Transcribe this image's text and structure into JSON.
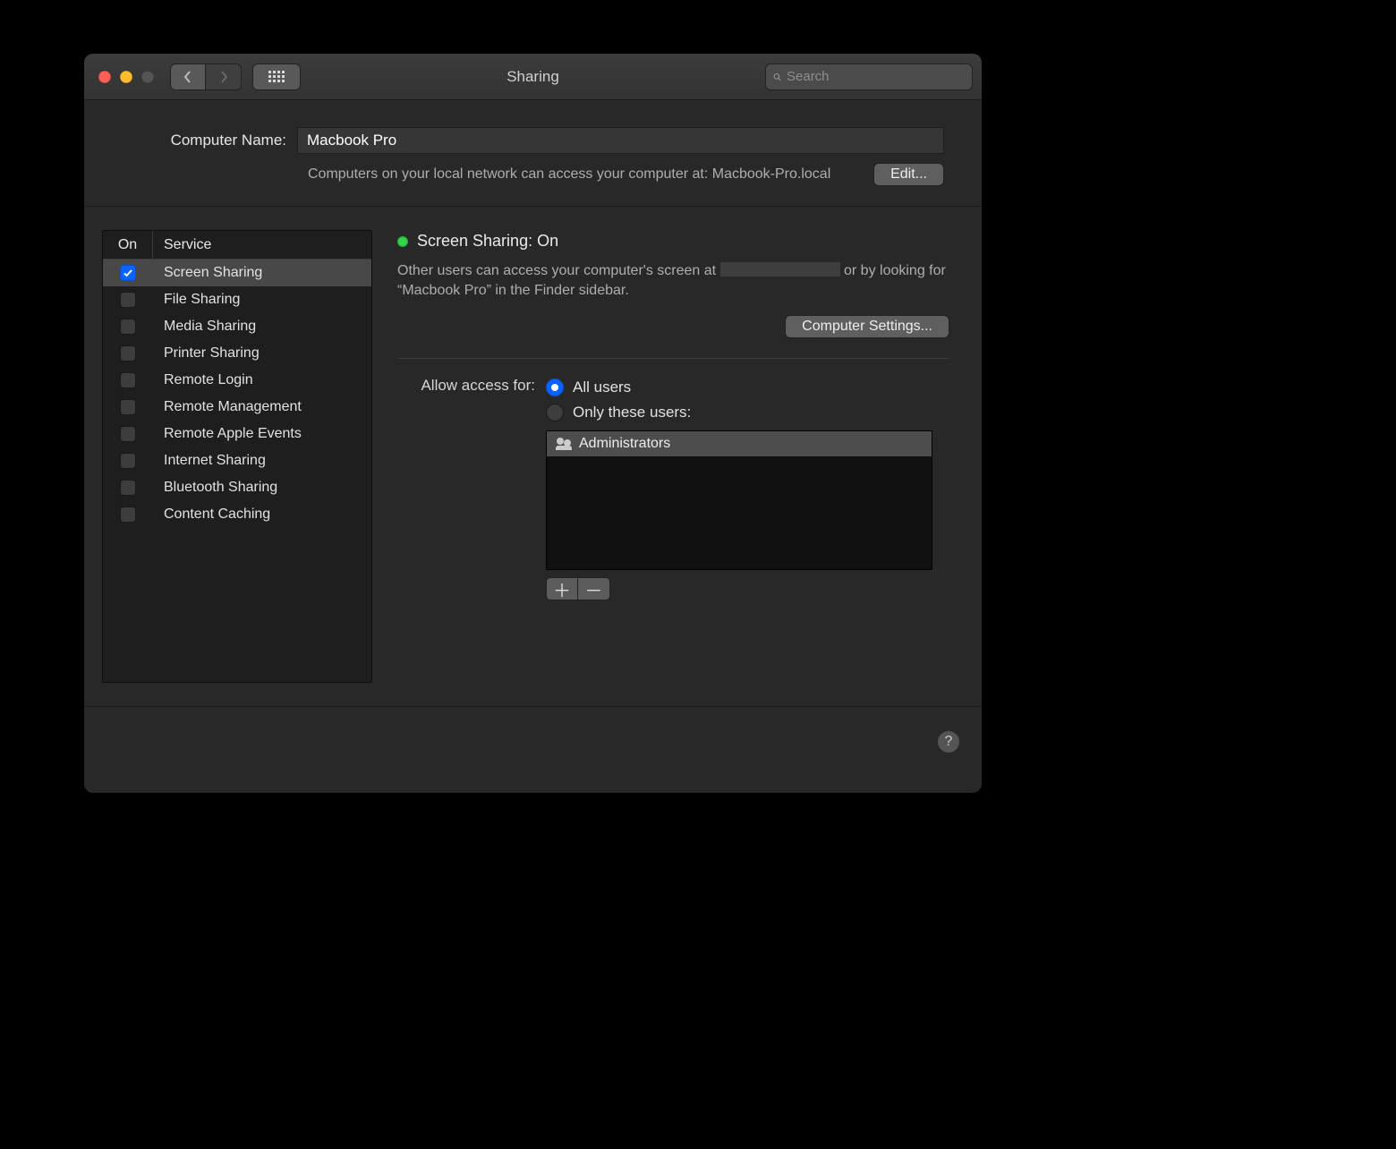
{
  "window": {
    "title": "Sharing"
  },
  "search": {
    "placeholder": "Search"
  },
  "header": {
    "nameLabel": "Computer Name:",
    "nameValue": "Macbook Pro",
    "subtext": "Computers on your local network can access your computer at: Macbook-Pro.local",
    "editLabel": "Edit..."
  },
  "services": {
    "head": {
      "on": "On",
      "service": "Service"
    },
    "rows": [
      {
        "id": "screen-sharing",
        "label": "Screen Sharing",
        "on": true,
        "selected": true
      },
      {
        "id": "file-sharing",
        "label": "File Sharing",
        "on": false,
        "selected": false
      },
      {
        "id": "media-sharing",
        "label": "Media Sharing",
        "on": false,
        "selected": false
      },
      {
        "id": "printer-sharing",
        "label": "Printer Sharing",
        "on": false,
        "selected": false
      },
      {
        "id": "remote-login",
        "label": "Remote Login",
        "on": false,
        "selected": false
      },
      {
        "id": "remote-management",
        "label": "Remote Management",
        "on": false,
        "selected": false
      },
      {
        "id": "remote-apple-events",
        "label": "Remote Apple Events",
        "on": false,
        "selected": false
      },
      {
        "id": "internet-sharing",
        "label": "Internet Sharing",
        "on": false,
        "selected": false
      },
      {
        "id": "bluetooth-sharing",
        "label": "Bluetooth Sharing",
        "on": false,
        "selected": false
      },
      {
        "id": "content-caching",
        "label": "Content Caching",
        "on": false,
        "selected": false
      }
    ]
  },
  "detail": {
    "statusTitle": "Screen Sharing: On",
    "statusColor": "#32d74b",
    "descPrefix": "Other users can access your computer's screen at ",
    "descSuffix": " or by looking for “Macbook Pro” in the Finder sidebar.",
    "computerSettings": "Computer Settings...",
    "accessLabel": "Allow access for:",
    "optAll": "All users",
    "optOnly": "Only these users:",
    "selected": "all",
    "users": [
      {
        "label": "Administrators"
      }
    ]
  }
}
